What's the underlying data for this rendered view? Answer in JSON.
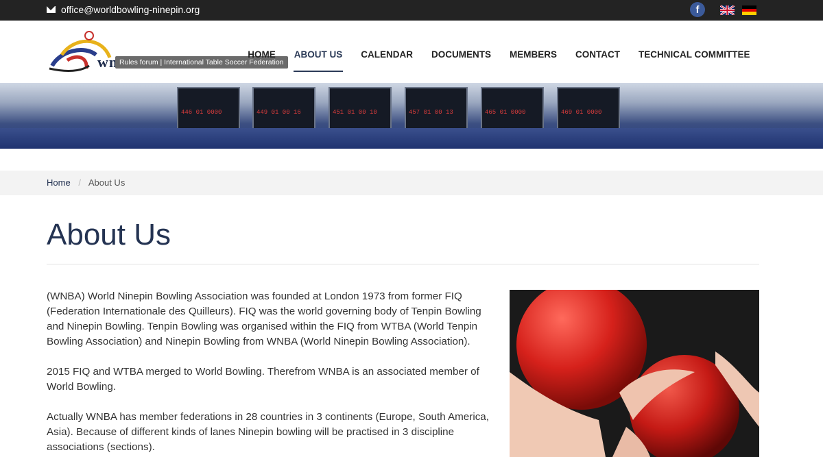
{
  "topbar": {
    "email": "office@worldbowling-ninepin.org"
  },
  "icons": {
    "mail": "envelope-icon",
    "facebook": "facebook-icon",
    "flag_en": "uk-flag-icon",
    "flag_de": "german-flag-icon"
  },
  "facebook_glyph": "f",
  "logo": {
    "word": "wnba",
    "tooltip": "Rules forum | International Table Soccer Federation"
  },
  "nav": {
    "items": [
      {
        "label": "HOME"
      },
      {
        "label": "ABOUT US"
      },
      {
        "label": "CALENDAR"
      },
      {
        "label": "DOCUMENTS"
      },
      {
        "label": "MEMBERS"
      },
      {
        "label": "CONTACT"
      },
      {
        "label": "TECHNICAL COMMITTEE"
      }
    ],
    "active": "ABOUT US"
  },
  "banner": {
    "scores": [
      "446 01 0000",
      "449 01 00 16",
      "451 01 00 10",
      "457 01 00 13",
      "465 01 0000",
      "469 01 0000"
    ]
  },
  "breadcrumb": {
    "home": "Home",
    "separator": "/",
    "current": "About Us"
  },
  "page": {
    "title": "About Us",
    "paragraphs": [
      "(WNBA) World Ninepin Bowling Association was founded at London 1973 from former FIQ (Federation Internationale des Quilleurs). FIQ was the world governing body of Tenpin Bowling and Ninepin Bowling. Tenpin Bowling was organised within the FIQ from WTBA (World Tenpin Bowling Association) and Ninepin Bowling from WNBA (World Ninepin Bowling Association).",
      "2015 FIQ and WTBA merged to World Bowling. Therefrom WNBA is an associated member of World Bowling.",
      "Actually WNBA has member federations in 28 countries in 3 continents (Europe, South America, Asia). Because of different kinds of lanes Ninepin bowling will be practised in 3 discipline associations (sections)."
    ]
  },
  "colors": {
    "topbar": "#232323",
    "accent": "#243352",
    "crumb_bg": "#f3f3f3"
  }
}
